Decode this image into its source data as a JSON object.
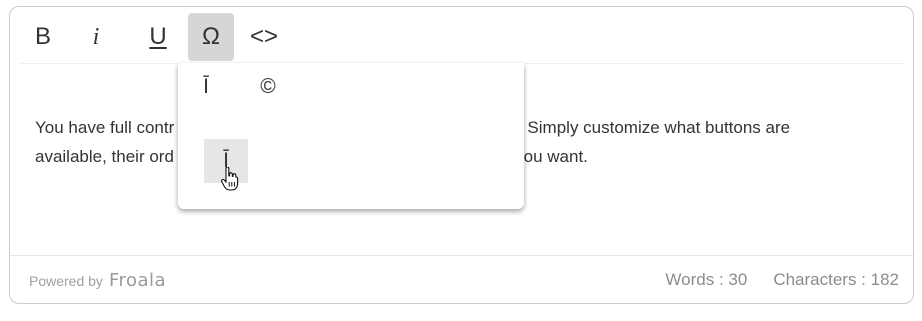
{
  "toolbar": {
    "bold": "B",
    "italic": "i",
    "underline": "U",
    "special_characters": "Ω",
    "code_view": "<>"
  },
  "special_characters_menu": {
    "items": [
      "Ī",
      "©",
      "Ī"
    ]
  },
  "content": {
    "paragraph_visible_left_1": "You have full contr",
    "paragraph_visible_right_1": "ity. Simply customize what buttons are",
    "paragraph_visible_left_2": "available, their ord",
    "paragraph_visible_right_2": "y you want."
  },
  "footer": {
    "powered_by": "Powered by",
    "brand": "Froala",
    "words": "Words : 30",
    "characters": "Characters : 182"
  },
  "icons": {
    "cursor": "hand-pointer-icon"
  }
}
